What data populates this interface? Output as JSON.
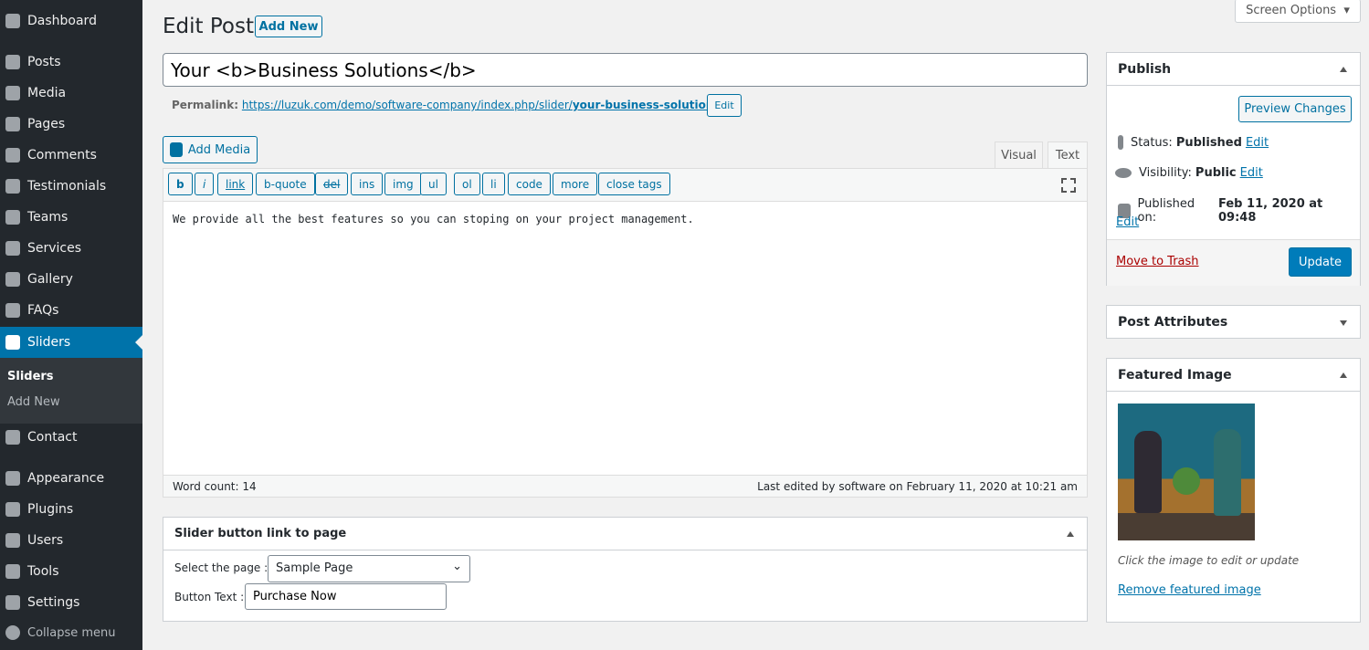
{
  "sidebar": {
    "items": [
      {
        "label": "Dashboard",
        "icon": "dashboard-icon"
      },
      {
        "label": "Posts",
        "icon": "pin-icon"
      },
      {
        "label": "Media",
        "icon": "media-icon"
      },
      {
        "label": "Pages",
        "icon": "pages-icon"
      },
      {
        "label": "Comments",
        "icon": "comments-icon"
      },
      {
        "label": "Testimonials",
        "icon": "testimonials-icon"
      },
      {
        "label": "Teams",
        "icon": "groups-icon"
      },
      {
        "label": "Services",
        "icon": "update-icon"
      },
      {
        "label": "Gallery",
        "icon": "gallery-icon"
      },
      {
        "label": "FAQs",
        "icon": "faq-icon"
      },
      {
        "label": "Sliders",
        "icon": "slides-icon"
      },
      {
        "label": "Contact",
        "icon": "email-icon"
      },
      {
        "label": "Appearance",
        "icon": "brush-icon"
      },
      {
        "label": "Plugins",
        "icon": "plugin-icon"
      },
      {
        "label": "Users",
        "icon": "users-icon"
      },
      {
        "label": "Tools",
        "icon": "wrench-icon"
      },
      {
        "label": "Settings",
        "icon": "settings-icon"
      }
    ],
    "submenu": [
      "Sliders",
      "Add New"
    ],
    "collapse": "Collapse menu",
    "accent": "#0073aa"
  },
  "screen_options": "Screen Options",
  "header": {
    "title": "Edit Post",
    "add_new": "Add New"
  },
  "post": {
    "title": "Your <b>Business Solutions</b>",
    "permalink_label": "Permalink:",
    "permalink_base": "https://luzuk.com/demo/software-company/index.php/slider/",
    "permalink_slug": "your-business-solutions",
    "permalink_end": "/",
    "permalink_edit": "Edit"
  },
  "editor": {
    "add_media": "Add Media",
    "tab_visual": "Visual",
    "tab_text": "Text",
    "quicktags": [
      "b",
      "i",
      "link",
      "b-quote",
      "del",
      "ins",
      "img",
      "ul",
      "ol",
      "li",
      "code",
      "more",
      "close tags"
    ],
    "content": "We provide all the best features so you can stoping on your project management.",
    "word_count": "Word count: 14",
    "last_edited": "Last edited by software on February 11, 2020 at 10:21 am"
  },
  "slider_box": {
    "title": "Slider button link to page",
    "select_label": "Select the page :",
    "select_value": "Sample Page",
    "button_label": "Button Text :",
    "button_value": "Purchase Now"
  },
  "publish": {
    "title": "Publish",
    "preview": "Preview Changes",
    "status_label": "Status:",
    "status": "Published",
    "visibility_label": "Visibility:",
    "visibility": "Public",
    "published_label": "Published on:",
    "published": "Feb 11, 2020 at 09:48",
    "edit": "Edit",
    "trash": "Move to Trash",
    "update": "Update"
  },
  "attributes": {
    "title": "Post Attributes"
  },
  "featured": {
    "title": "Featured Image",
    "hint": "Click the image to edit or update",
    "remove": "Remove featured image"
  }
}
